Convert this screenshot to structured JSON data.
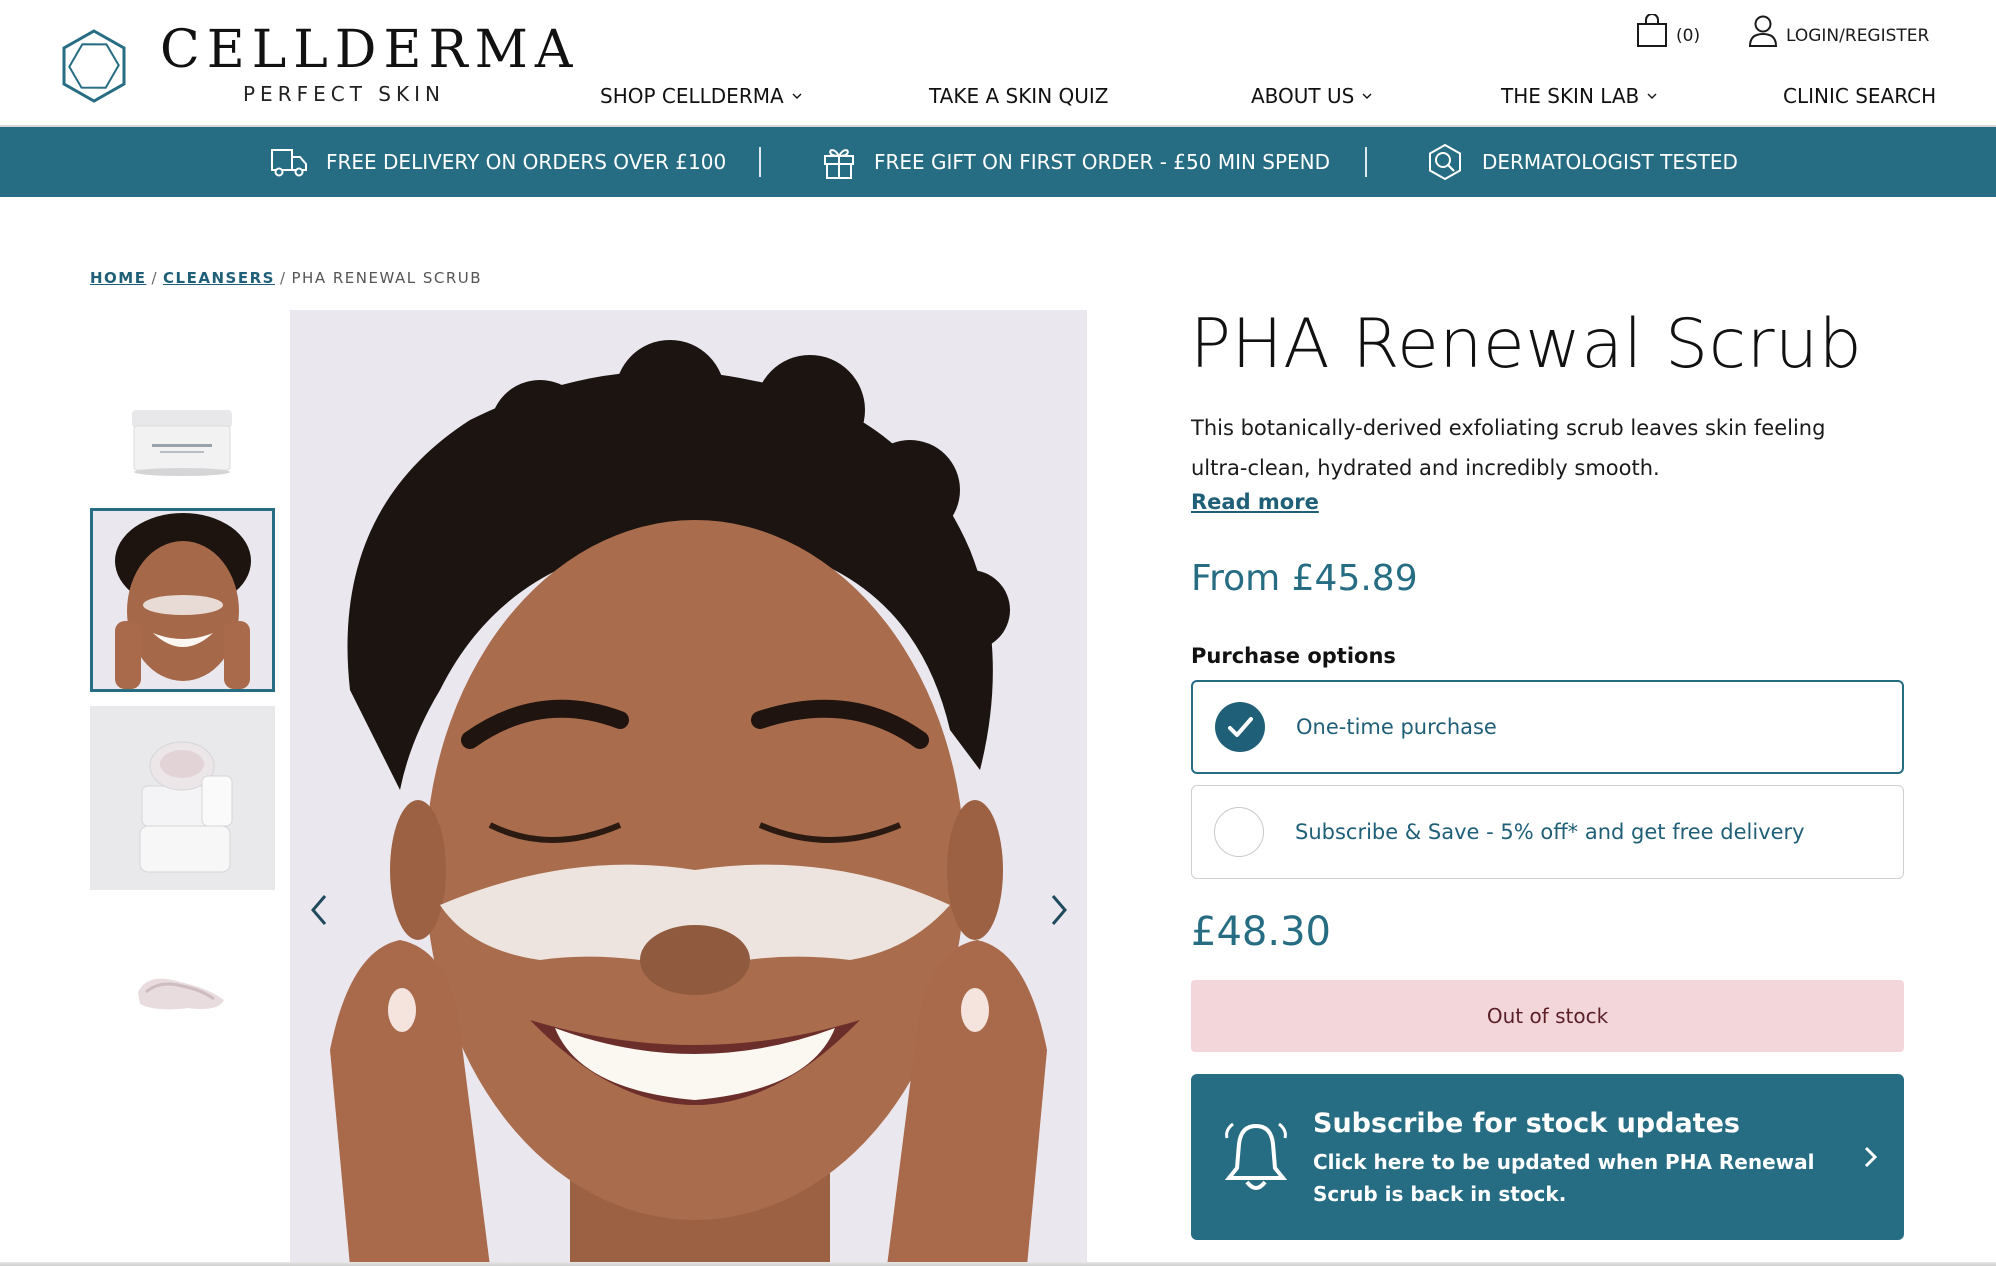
{
  "brand": {
    "name": "CELLDERMA",
    "tagline": "PERFECT SKIN"
  },
  "header": {
    "cart_count": "(0)",
    "login_label": "LOGIN/REGISTER",
    "nav": [
      {
        "label": "SHOP CELLDERMA",
        "has_dropdown": true
      },
      {
        "label": "TAKE A SKIN QUIZ",
        "has_dropdown": false
      },
      {
        "label": "ABOUT US",
        "has_dropdown": true
      },
      {
        "label": "THE SKIN LAB",
        "has_dropdown": true
      },
      {
        "label": "CLINIC SEARCH",
        "has_dropdown": false
      }
    ]
  },
  "banner": {
    "items": [
      {
        "icon": "truck-icon",
        "text": "FREE DELIVERY ON ORDERS OVER £100"
      },
      {
        "icon": "gift-icon",
        "text": "FREE GIFT ON FIRST ORDER - £50 MIN SPEND"
      },
      {
        "icon": "magnifier-icon",
        "text": "DERMATOLOGIST TESTED"
      }
    ]
  },
  "breadcrumb": {
    "home": "HOME",
    "category": "CLEANSERS",
    "current": "PHA RENEWAL SCRUB"
  },
  "product": {
    "title": "PHA Renewal Scrub",
    "description": "This botanically-derived exfoliating scrub leaves skin feeling ultra-clean, hydrated and incredibly smooth.",
    "read_more": "Read more",
    "from_price": "From £45.89",
    "purchase_options_label": "Purchase options",
    "options": [
      {
        "label": "One-time purchase",
        "selected": true
      },
      {
        "label": "Subscribe & Save - 5% off* and get free delivery",
        "selected": false
      }
    ],
    "price": "£48.30",
    "stock_status": "Out of stock",
    "notify": {
      "title": "Subscribe for stock updates",
      "text": "Click here to be updated when PHA Renewal Scrub is back in stock."
    }
  },
  "colors": {
    "brand_teal": "#266d84",
    "text_teal": "#1f5f78",
    "out_of_stock_bg": "#f3d6da"
  }
}
